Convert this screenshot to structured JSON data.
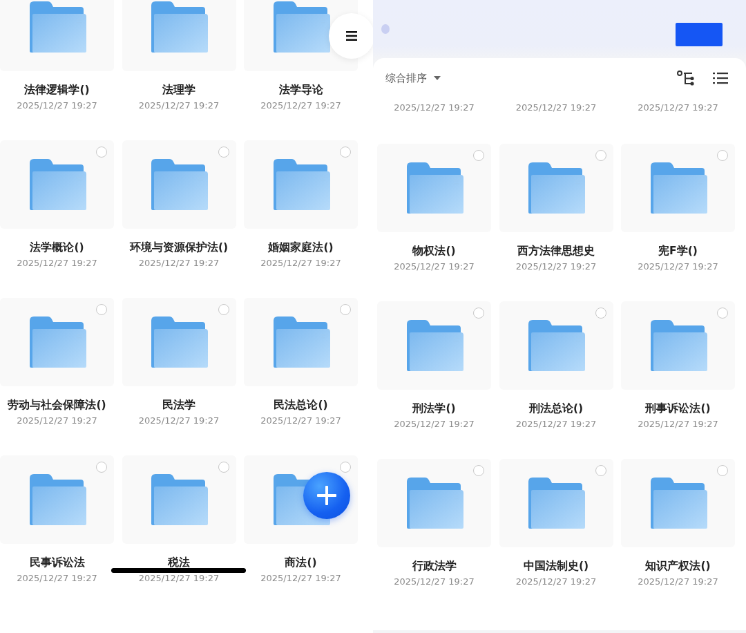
{
  "left_screen": {
    "folders": [
      {
        "name": "法律逻辑学()",
        "date": "2025/12/27 19:27"
      },
      {
        "name": "法理学",
        "date": "2025/12/27 19:27"
      },
      {
        "name": "法学导论",
        "date": "2025/12/27 19:27"
      },
      {
        "name": "法学概论()",
        "date": "2025/12/27 19:27",
        "selected": false
      },
      {
        "name": "环境与资源保护法()",
        "date": "2025/12/27 19:27",
        "selected": false
      },
      {
        "name": "婚姻家庭法()",
        "date": "2025/12/27 19:27",
        "selected": false
      },
      {
        "name": "劳动与社会保障法()",
        "date": "2025/12/27 19:27",
        "selected": false
      },
      {
        "name": "民法学",
        "date": "2025/12/27 19:27",
        "selected": false
      },
      {
        "name": "民法总论()",
        "date": "2025/12/27 19:27",
        "selected": false
      },
      {
        "name": "民事诉讼法",
        "date": "2025/12/27 19:27",
        "selected": false
      },
      {
        "name": "税法",
        "date": "2025/12/27 19:27",
        "selected": false
      },
      {
        "name": "商法()",
        "date": "2025/12/27 19:27",
        "selected": false
      }
    ]
  },
  "right_screen": {
    "sort_label": "综合排序",
    "partial_dates": [
      "2025/12/27 19:27",
      "2025/12/27 19:27",
      "2025/12/27 19:27"
    ],
    "folders": [
      {
        "name": "物权法()",
        "date": "2025/12/27 19:27",
        "selected": false
      },
      {
        "name": "西方法律思想史",
        "date": "2025/12/27 19:27",
        "selected": false
      },
      {
        "name": "宪F学()",
        "date": "2025/12/27 19:27",
        "selected": false
      },
      {
        "name": "刑法学()",
        "date": "2025/12/27 19:27",
        "selected": false
      },
      {
        "name": "刑法总论()",
        "date": "2025/12/27 19:27",
        "selected": false
      },
      {
        "name": "刑事诉讼法()",
        "date": "2025/12/27 19:27",
        "selected": false
      },
      {
        "name": "行政法学",
        "date": "2025/12/27 19:27",
        "selected": false
      },
      {
        "name": "中国法制史()",
        "date": "2025/12/27 19:27",
        "selected": false
      },
      {
        "name": "知识产权法()",
        "date": "2025/12/27 19:27",
        "selected": false
      }
    ]
  }
}
